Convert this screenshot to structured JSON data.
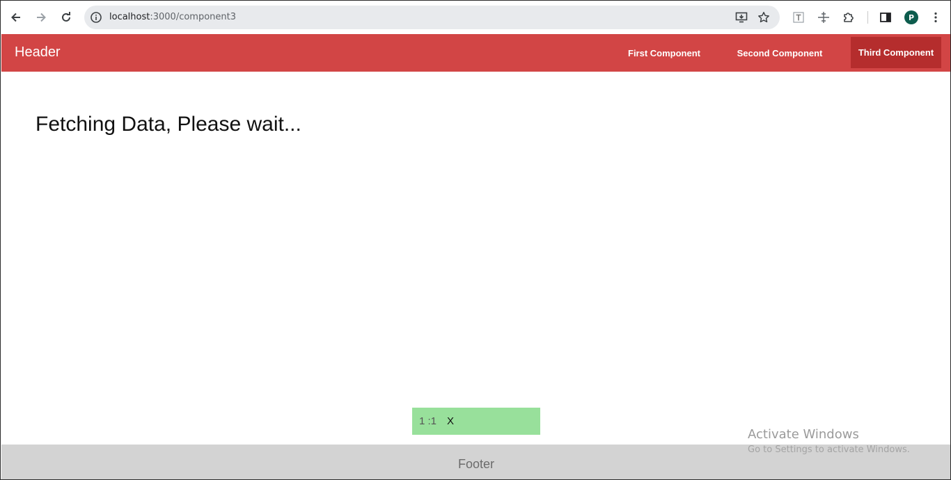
{
  "browser": {
    "url_host": "localhost",
    "url_path": ":3000/component3",
    "avatar_letter": "P",
    "icons": [
      "back-arrow-icon",
      "forward-arrow-icon",
      "reload-icon",
      "site-info-icon",
      "install-app-icon",
      "bookmark-star-icon",
      "text-extension-icon",
      "move-extension-icon",
      "extensions-puzzle-icon",
      "side-panel-icon",
      "kebab-menu-icon"
    ]
  },
  "header": {
    "brand": "Header",
    "nav": [
      {
        "label": "First Component",
        "active": false
      },
      {
        "label": "Second Component",
        "active": false
      },
      {
        "label": "Third Component",
        "active": true
      }
    ],
    "colors": {
      "bar": "#d24545",
      "active": "#b52d2d"
    }
  },
  "main": {
    "loading_text": "Fetching Data, Please wait..."
  },
  "toast": {
    "count": "1 :1",
    "close_label": "X",
    "color": "#98e09b"
  },
  "footer": {
    "label": "Footer"
  },
  "watermark": {
    "title": "Activate Windows",
    "subtitle": "Go to Settings to activate Windows."
  }
}
